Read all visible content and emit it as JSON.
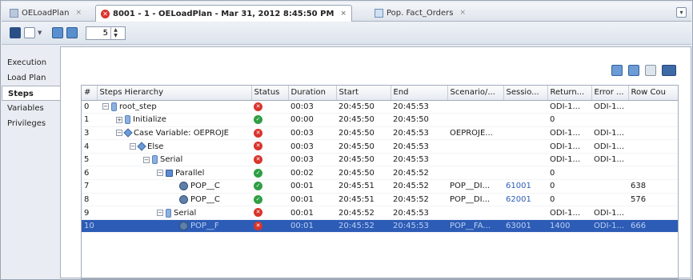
{
  "tabs": [
    {
      "label": "OELoadPlan",
      "icon": "load-plan-icon",
      "active": false
    },
    {
      "label": "8001 - 1 - OELoadPlan - Mar 31, 2012 8:45:50 PM",
      "icon": "error-status-icon",
      "active": true
    },
    {
      "label": "Pop. Fact_Orders",
      "icon": "datastore-icon",
      "active": false
    }
  ],
  "tab_close_glyph": "×",
  "toolbar": {
    "refresh_value": "5"
  },
  "sidenav": {
    "items": [
      {
        "label": "Execution",
        "active": false
      },
      {
        "label": "Load Plan",
        "active": false
      },
      {
        "label": "Steps",
        "active": true
      },
      {
        "label": "Variables",
        "active": false
      },
      {
        "label": "Privileges",
        "active": false
      }
    ]
  },
  "table": {
    "columns": [
      "#",
      "Steps Hierarchy",
      "Status",
      "Duration",
      "Start",
      "End",
      "Scenario/...",
      "Sessio...",
      "Return...",
      "Error ...",
      "Row Cou"
    ],
    "rows": [
      {
        "num": "0",
        "name": "root_step",
        "level": 0,
        "expander": "−",
        "icon": "serial-step-icon",
        "status": "error",
        "duration": "00:03",
        "start": "20:45:50",
        "end": "20:45:53",
        "scenario": "",
        "session": "",
        "return": "ODI-1...",
        "error": "ODI-1...",
        "rows": ""
      },
      {
        "num": "1",
        "name": "Initialize",
        "level": 1,
        "expander": "+",
        "icon": "serial-step-icon",
        "status": "done",
        "duration": "00:00",
        "start": "20:45:50",
        "end": "20:45:50",
        "scenario": "",
        "session": "",
        "return": "0",
        "error": "",
        "rows": ""
      },
      {
        "num": "3",
        "name": "Case Variable: OEPROJE",
        "level": 1,
        "expander": "−",
        "icon": "case-step-icon",
        "status": "error",
        "duration": "00:03",
        "start": "20:45:50",
        "end": "20:45:53",
        "scenario": "OEPROJE...",
        "session": "",
        "return": "ODI-1...",
        "error": "ODI-1...",
        "rows": ""
      },
      {
        "num": "4",
        "name": "Else",
        "level": 2,
        "expander": "−",
        "icon": "case-step-icon",
        "status": "error",
        "duration": "00:03",
        "start": "20:45:50",
        "end": "20:45:53",
        "scenario": "",
        "session": "",
        "return": "ODI-1...",
        "error": "ODI-1...",
        "rows": ""
      },
      {
        "num": "5",
        "name": "Serial",
        "level": 3,
        "expander": "−",
        "icon": "serial-step-icon",
        "status": "error",
        "duration": "00:03",
        "start": "20:45:50",
        "end": "20:45:53",
        "scenario": "",
        "session": "",
        "return": "ODI-1...",
        "error": "ODI-1...",
        "rows": ""
      },
      {
        "num": "6",
        "name": "Parallel",
        "level": 4,
        "expander": "−",
        "icon": "parallel-step-icon",
        "status": "done",
        "duration": "00:02",
        "start": "20:45:50",
        "end": "20:45:52",
        "scenario": "",
        "session": "",
        "return": "0",
        "error": "",
        "rows": ""
      },
      {
        "num": "7",
        "name": "POP__C",
        "level": 5,
        "expander": "",
        "icon": "scenario-step-icon",
        "status": "done",
        "duration": "00:01",
        "start": "20:45:51",
        "end": "20:45:52",
        "scenario": "POP__DI...",
        "session": "61001",
        "return": "0",
        "error": "",
        "rows": "638"
      },
      {
        "num": "8",
        "name": "POP__C",
        "level": 5,
        "expander": "",
        "icon": "scenario-step-icon",
        "status": "done",
        "duration": "00:01",
        "start": "20:45:51",
        "end": "20:45:52",
        "scenario": "POP__DI...",
        "session": "62001",
        "return": "0",
        "error": "",
        "rows": "576"
      },
      {
        "num": "9",
        "name": "Serial",
        "level": 4,
        "expander": "−",
        "icon": "serial-step-icon",
        "status": "error",
        "duration": "00:01",
        "start": "20:45:52",
        "end": "20:45:53",
        "scenario": "",
        "session": "",
        "return": "ODI-1...",
        "error": "ODI-1...",
        "rows": ""
      },
      {
        "num": "10",
        "name": "POP__F",
        "level": 5,
        "expander": "",
        "icon": "scenario-step-icon",
        "status": "error",
        "duration": "00:01",
        "start": "20:45:52",
        "end": "20:45:53",
        "scenario": "POP__FA...",
        "session": "63001",
        "return": "1400",
        "error": "ODI-1...",
        "rows": "666",
        "selected": true
      }
    ]
  },
  "colors": {
    "selection": "#2d5cb6",
    "error": "#d8342c",
    "done": "#2f9e44",
    "link": "#2d5cb6"
  }
}
